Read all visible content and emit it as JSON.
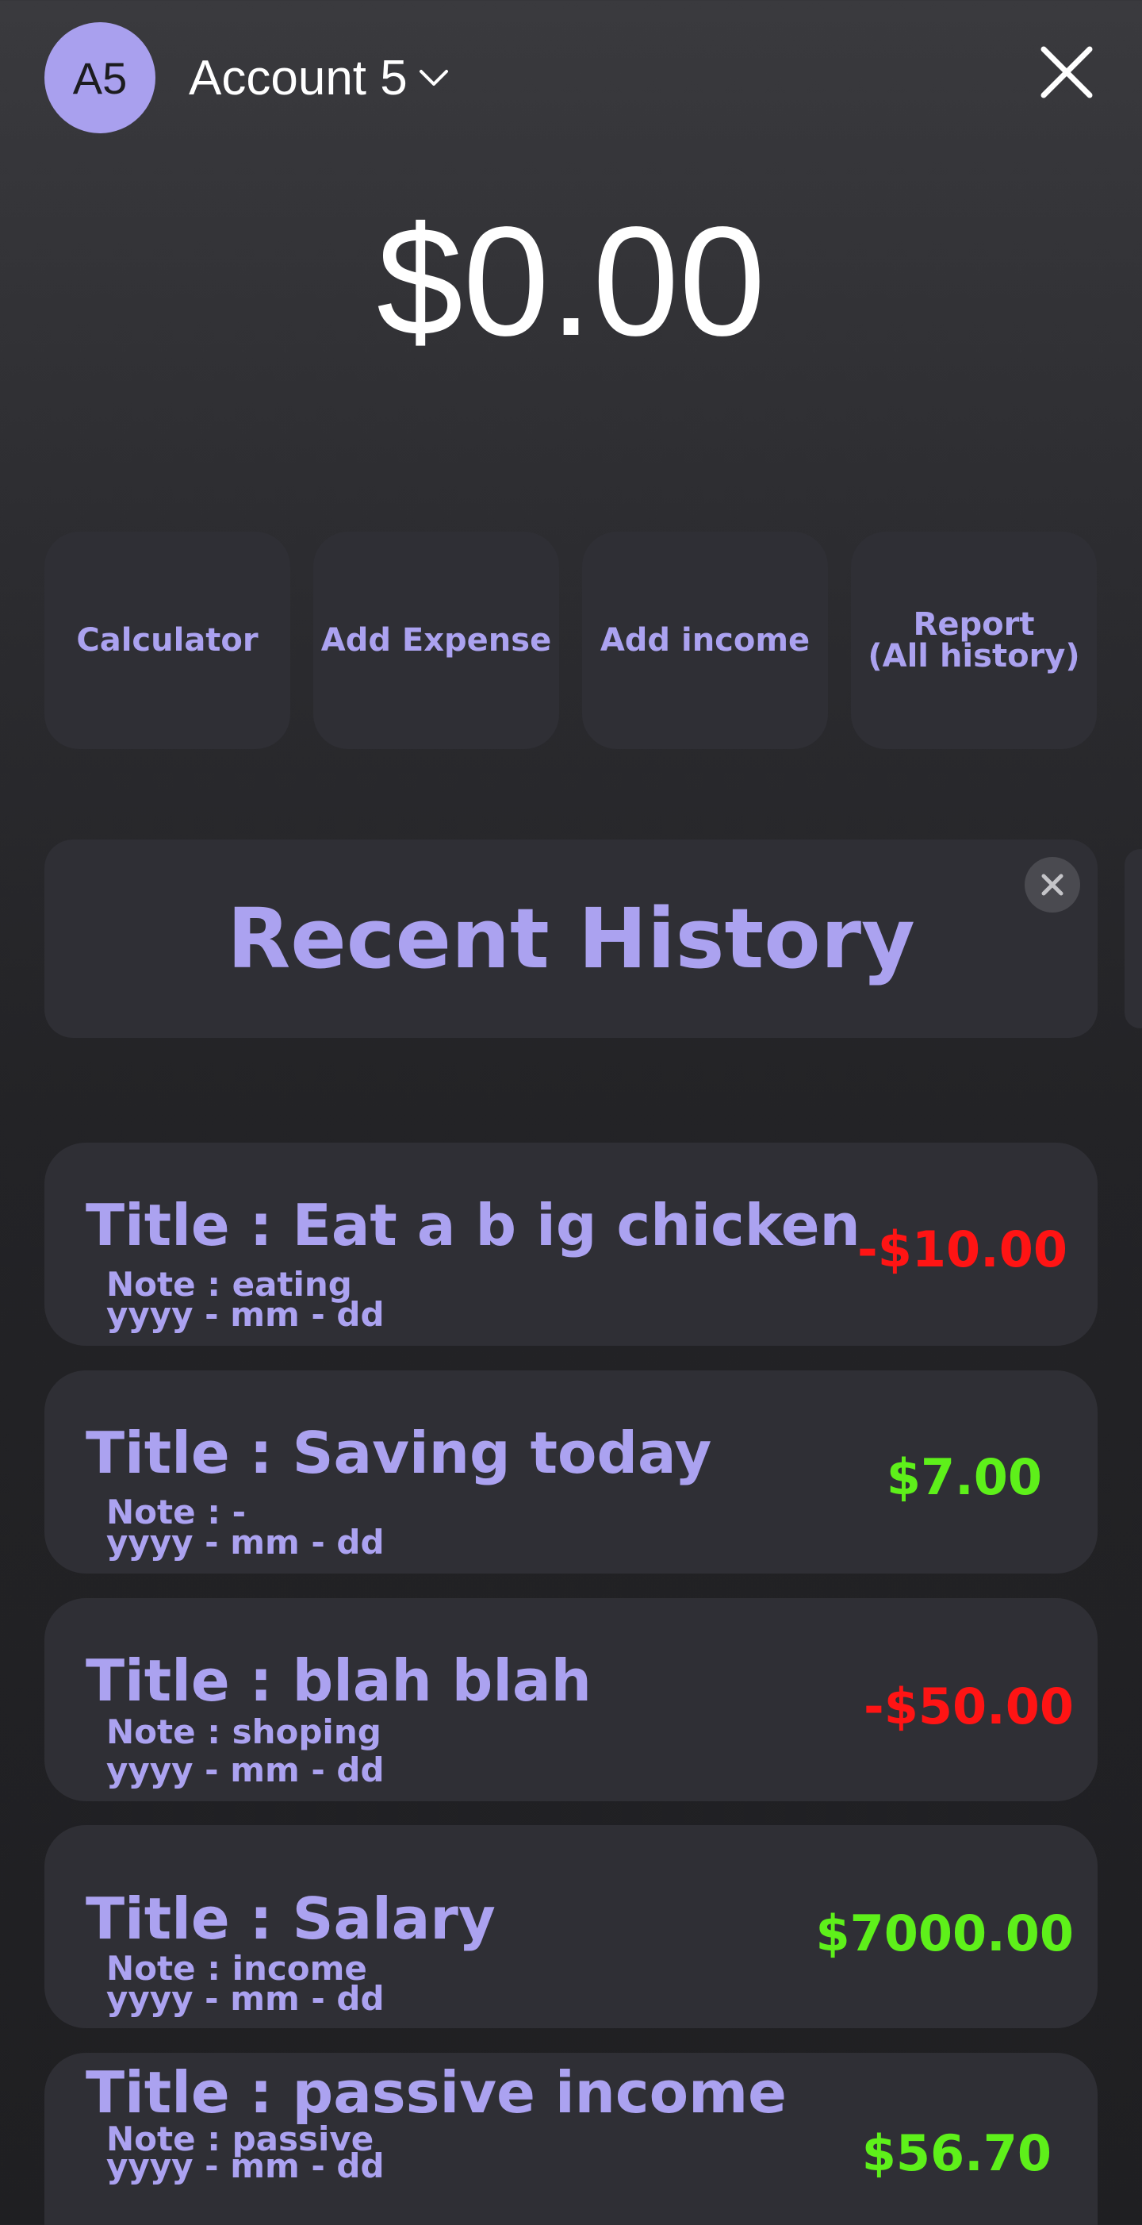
{
  "header": {
    "avatar_initials": "A5",
    "account_name": "Account 5",
    "icons": {
      "account_menu": "chevron-down-icon",
      "close": "close-icon"
    }
  },
  "balance": "$0.00",
  "actions": [
    {
      "label": "Calculator"
    },
    {
      "label": "Add Expense"
    },
    {
      "label": "Add income"
    },
    {
      "label": "Report\n(All history)"
    }
  ],
  "history": {
    "title": "Recent History",
    "dismiss_icon": "close-icon"
  },
  "transactions": [
    {
      "title": "Title : Eat a b ig chicken",
      "note": "Note : eating",
      "date": "yyyy - mm - dd",
      "amount": "-$10.00",
      "kind": "expense"
    },
    {
      "title": "Title : Saving today",
      "note": "Note : -",
      "date": "yyyy - mm - dd",
      "amount": "$7.00",
      "kind": "income"
    },
    {
      "title": "Title : blah blah",
      "note": "Note : shoping",
      "date": "yyyy - mm - dd",
      "amount": "-$50.00",
      "kind": "expense"
    },
    {
      "title": "Title : Salary",
      "note": "Note : income",
      "date": "yyyy - mm - dd",
      "amount": "$7000.00",
      "kind": "income"
    },
    {
      "title": "Title : passive income",
      "note": "Note : passive",
      "date": "yyyy - mm - dd",
      "amount": "$56.70",
      "kind": "income"
    }
  ],
  "colors": {
    "accent": "#aba2f0",
    "avatar_bg": "#a9a0ee",
    "card_bg": "#2f2f35",
    "expense": "#ff1414",
    "income": "#5ef01a"
  }
}
